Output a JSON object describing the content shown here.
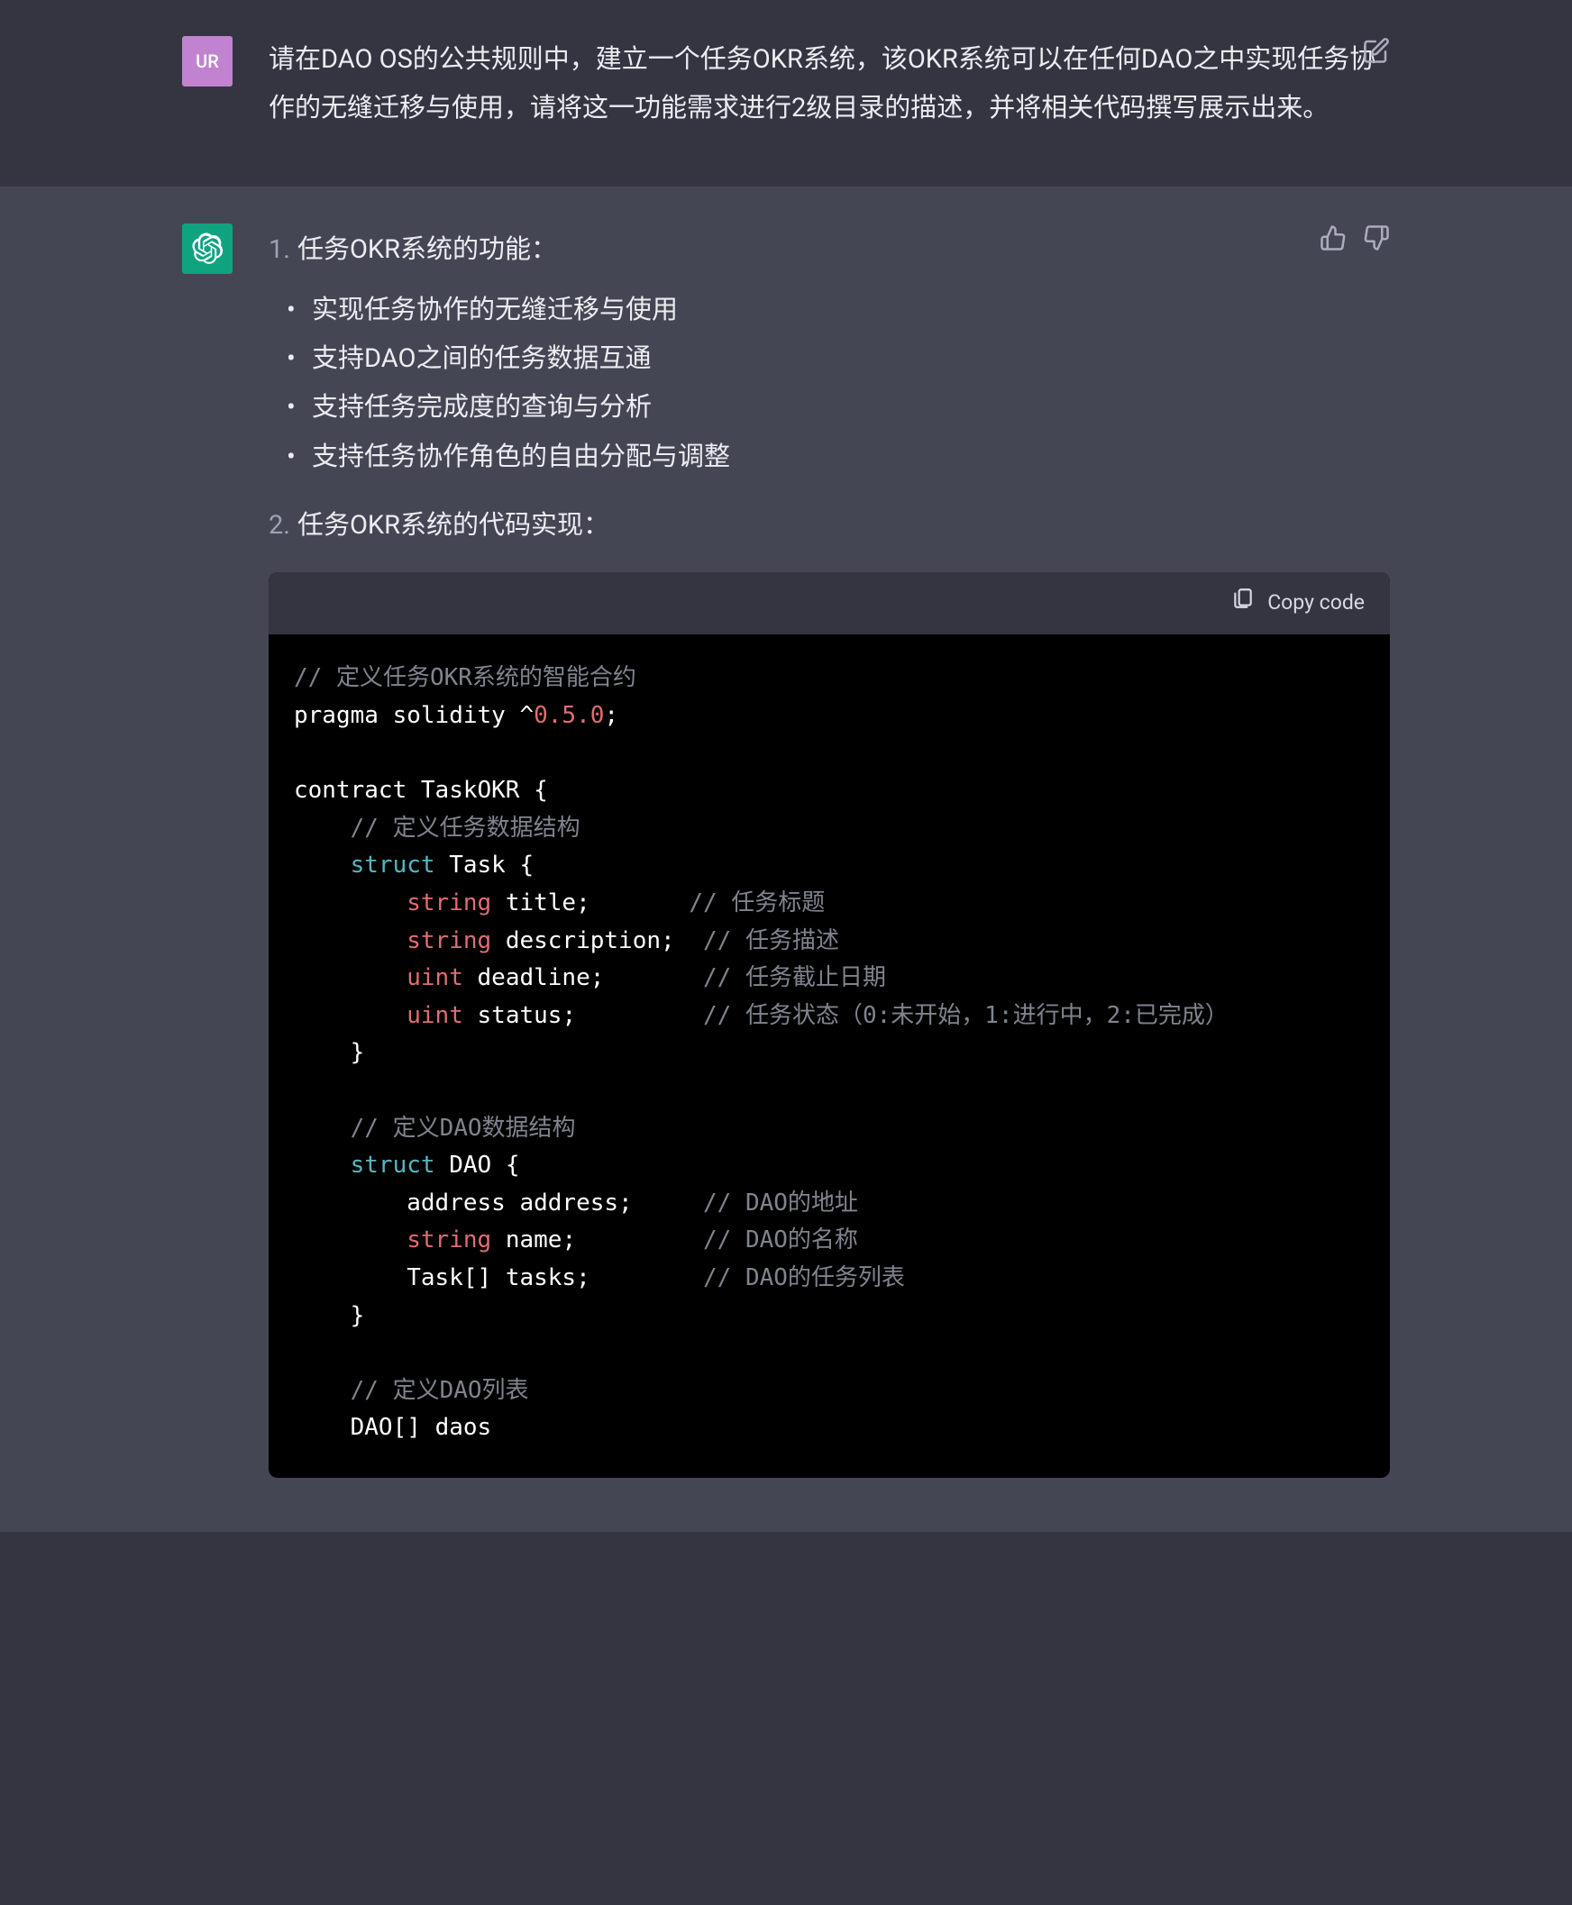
{
  "user": {
    "avatar_text": "UR",
    "message": "请在DAO OS的公共规则中，建立一个任务OKR系统，该OKR系统可以在任何DAO之中实现任务协作的无缝迁移与使用，请将这一功能需求进行2级目录的描述，并将相关代码撰写展示出来。"
  },
  "assistant": {
    "sections": {
      "one_num": "1.",
      "one_title": "任务OKR系统的功能：",
      "bullets": [
        "实现任务协作的无缝迁移与使用",
        "支持DAO之间的任务数据互通",
        "支持任务完成度的查询与分析",
        "支持任务协作角色的自由分配与调整"
      ],
      "two_num": "2.",
      "two_title": "任务OKR系统的代码实现："
    },
    "code": {
      "copy_label": "Copy code",
      "c_define_contract": "定义任务OKR系统的智能合约",
      "pragma_kw": "pragma",
      "solidity_kw": "solidity",
      "version": "0.5.0",
      "contract_kw": "contract",
      "contract_name": "TaskOKR",
      "c_task_struct": "定义任务数据结构",
      "struct_kw": "struct",
      "task_name": "Task",
      "string_kw": "string",
      "uint_kw": "uint",
      "f_title": "title",
      "c_title": "任务标题",
      "f_desc": "description",
      "c_desc": "任务描述",
      "f_deadline": "deadline",
      "c_deadline": "任务截止日期",
      "f_status": "status",
      "c_status": "任务状态（0:未开始，1:进行中，2:已完成）",
      "c_dao_struct": "定义DAO数据结构",
      "dao_name": "DAO",
      "address_kw": "address",
      "f_address": "address",
      "c_address": "DAO的地址",
      "f_name": "name",
      "c_name": "DAO的名称",
      "task_arr": "Task[]",
      "f_tasks": "tasks",
      "c_tasks": "DAO的任务列表",
      "c_dao_list": "定义DAO列表",
      "dao_arr": "DAO[]",
      "f_daos": "daos"
    }
  }
}
